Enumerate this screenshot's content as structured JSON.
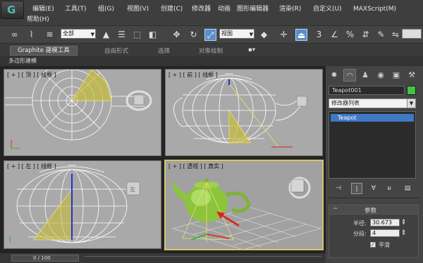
{
  "menubar": {
    "items": [
      {
        "label": "编辑(E)"
      },
      {
        "label": "工具(T)"
      },
      {
        "label": "组(G)"
      },
      {
        "label": "视图(V)"
      },
      {
        "label": "创建(C)"
      },
      {
        "label": "修改器"
      },
      {
        "label": "动画"
      },
      {
        "label": "图形编辑器"
      },
      {
        "label": "渲染(R)"
      },
      {
        "label": "自定义(U)"
      },
      {
        "label": "MAXScript(M)"
      }
    ],
    "help_label": "帮助(H)"
  },
  "toolbar": {
    "selection_filter": "全部",
    "ref_coord": "视图"
  },
  "ribbon": {
    "tabs": [
      {
        "label": "Graphite 建模工具"
      },
      {
        "label": "自由形式"
      },
      {
        "label": "选择"
      },
      {
        "label": "对象绘制"
      }
    ],
    "panel_label": "多边形建模"
  },
  "viewports": {
    "top": {
      "label": "[ + ] [ 顶 ] [ 线框 ]"
    },
    "front": {
      "label": "[ + ] [ 前 ] [ 线框 ]"
    },
    "left": {
      "label": "[ + ] [ 左 ] [ 线框 ]"
    },
    "persp": {
      "label": "[ + ] [ 透视 ] [ 真实 ]"
    },
    "viewcube": {
      "top": "上",
      "front": "前",
      "left": "左"
    }
  },
  "command_panel": {
    "object_name": "Teapot001",
    "object_color": "#3ec640",
    "modifier_list": "修改器列表",
    "stack_item": "Teapot",
    "rollout_title": "参数",
    "radius_label": "半径:",
    "radius_value": "30.673",
    "segments_label": "分段:",
    "segments_value": "4",
    "smooth_label": "平滑",
    "smooth_checked": true
  },
  "status": {
    "time_slider": "0 / 100"
  }
}
